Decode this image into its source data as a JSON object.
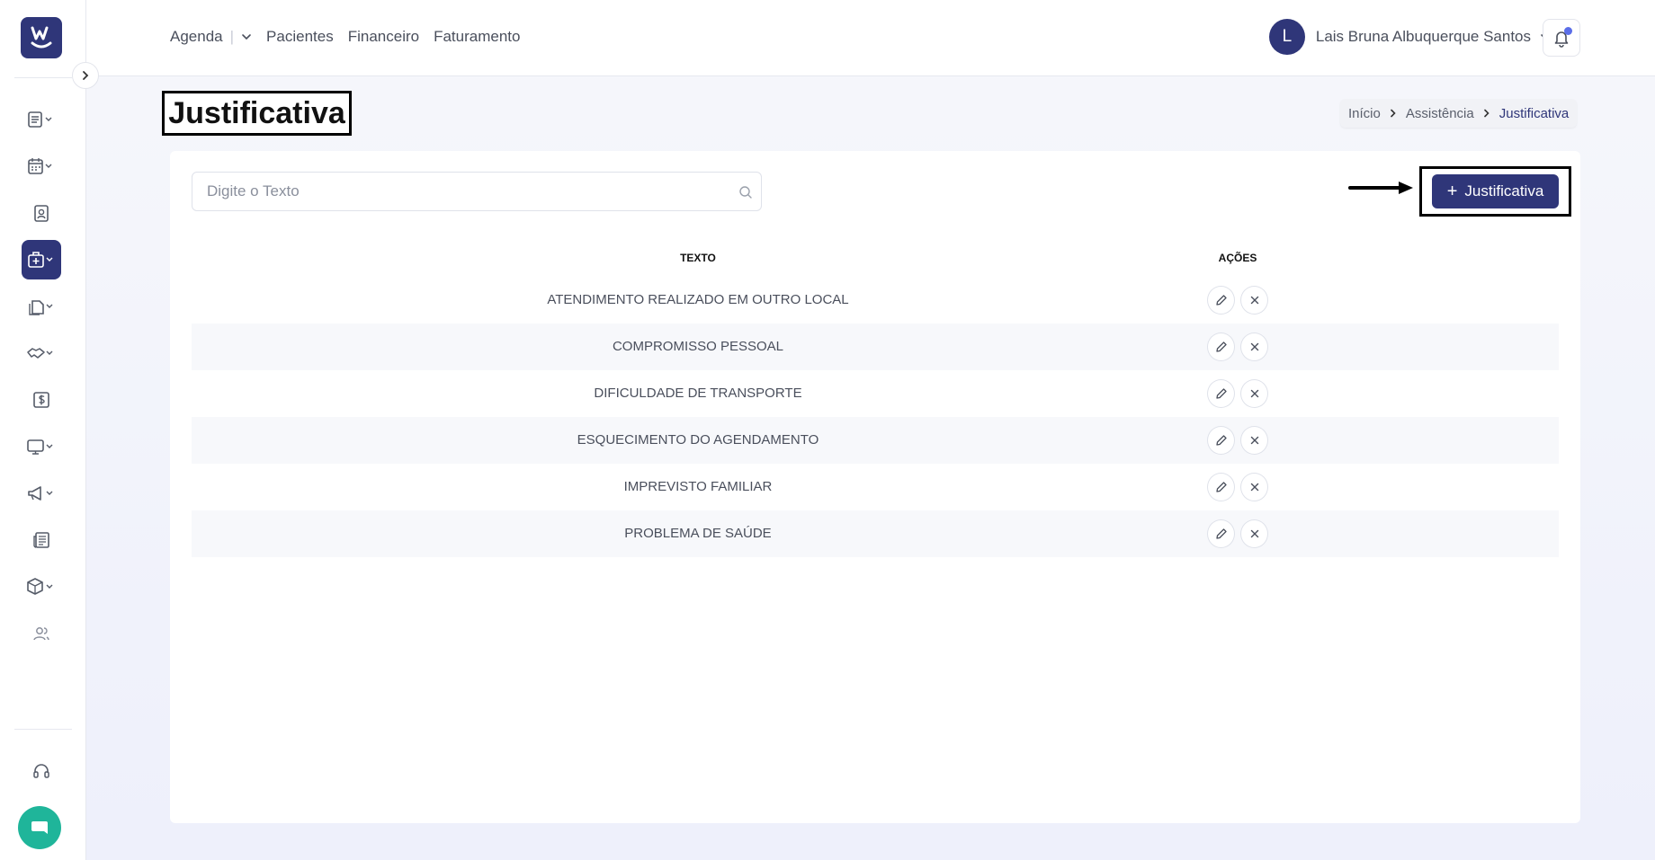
{
  "colors": {
    "primary": "#2f3679",
    "accent": "#5b6ee8",
    "chat": "#1fb59a"
  },
  "logo": {
    "icon": "w-logo-icon"
  },
  "sidebar": {
    "items": [
      {
        "icon": "file-list-icon",
        "has_chevron": true,
        "active": false
      },
      {
        "icon": "calendar-icon",
        "has_chevron": true,
        "active": false
      },
      {
        "icon": "id-badge-icon",
        "has_chevron": false,
        "active": false
      },
      {
        "icon": "medical-bag-icon",
        "has_chevron": true,
        "active": true
      },
      {
        "icon": "documents-icon",
        "has_chevron": true,
        "active": false
      },
      {
        "icon": "handshake-icon",
        "has_chevron": true,
        "active": false
      },
      {
        "icon": "dollar-icon",
        "has_chevron": false,
        "active": false
      },
      {
        "icon": "monitor-icon",
        "has_chevron": true,
        "active": false
      },
      {
        "icon": "megaphone-icon",
        "has_chevron": true,
        "active": false
      },
      {
        "icon": "newspaper-icon",
        "has_chevron": false,
        "active": false
      },
      {
        "icon": "box-icon",
        "has_chevron": true,
        "active": false
      },
      {
        "icon": "users-icon",
        "has_chevron": false,
        "active": false
      }
    ],
    "support_icon": "headset-icon",
    "chat_icon": "chat-icon"
  },
  "topnav": {
    "agenda": "Agenda",
    "agenda_sep": "|",
    "pacientes": "Pacientes",
    "financeiro": "Financeiro",
    "faturamento": "Faturamento"
  },
  "user": {
    "initial": "L",
    "name": "Lais Bruna Albuquerque Santos"
  },
  "page": {
    "title": "Justificativa"
  },
  "breadcrumb": {
    "home": "Início",
    "section": "Assistência",
    "current": "Justificativa"
  },
  "search": {
    "placeholder": "Digite o Texto",
    "value": ""
  },
  "actions": {
    "add_label": "Justificativa",
    "add_plus": "+"
  },
  "table": {
    "columns": {
      "text": "TEXTO",
      "actions": "AÇÕES"
    },
    "rows": [
      {
        "texto": "ATENDIMENTO REALIZADO EM OUTRO LOCAL"
      },
      {
        "texto": "COMPROMISSO PESSOAL"
      },
      {
        "texto": "DIFICULDADE DE TRANSPORTE"
      },
      {
        "texto": "ESQUECIMENTO DO AGENDAMENTO"
      },
      {
        "texto": "IMPREVISTO FAMILIAR"
      },
      {
        "texto": "PROBLEMA DE SAÚDE"
      }
    ]
  }
}
